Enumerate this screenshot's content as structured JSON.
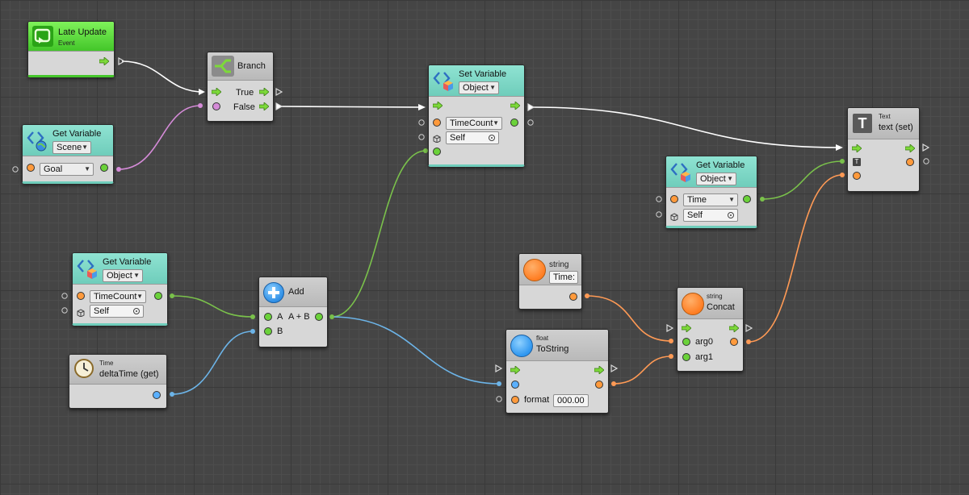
{
  "canvas": {
    "background": "#454545"
  },
  "colors": {
    "flow_wire": "#ffffff",
    "object_wire": "#ff9a55",
    "bool_wire": "#d58bd8",
    "float_wire": "#7ac14b",
    "deltatime_wire": "#6cb4e8"
  },
  "nodes": {
    "late_update": {
      "title": "Late Update",
      "subtitle": "Event",
      "icon": "loop-icon"
    },
    "branch": {
      "title": "Branch",
      "true_label": "True",
      "false_label": "False",
      "icon": "branch-icon"
    },
    "get_scene": {
      "title": "Get Variable",
      "scope": "Scene",
      "variable": "Goal",
      "icon": "variable-icon"
    },
    "set_variable": {
      "title": "Set Variable",
      "scope": "Object",
      "variable": "TimeCount",
      "target": "Self",
      "icon": "variable-icon"
    },
    "text_set": {
      "category": "Text",
      "title": "text (set)",
      "icon": "text-icon",
      "type_badge": "T"
    },
    "get_object_time": {
      "title": "Get Variable",
      "scope": "Object",
      "variable": "Time",
      "target": "Self",
      "icon": "variable-icon"
    },
    "get_object_timecount": {
      "title": "Get Variable",
      "scope": "Object",
      "variable": "TimeCount",
      "target": "Self",
      "icon": "variable-icon"
    },
    "add": {
      "title": "Add",
      "label_a": "A",
      "label_result": "A + B",
      "label_b": "B",
      "icon": "plus-icon"
    },
    "delta_time": {
      "category": "Time",
      "title": "deltaTime (get)",
      "icon": "clock-icon"
    },
    "string_literal": {
      "category": "string",
      "value": "Time:",
      "icon": "orange-circle-icon"
    },
    "concat": {
      "category": "string",
      "title": "Concat",
      "arg0": "arg0",
      "arg1": "arg1",
      "icon": "orange-circle-icon"
    },
    "to_string": {
      "category": "float",
      "title": "ToString",
      "format_label": "format",
      "format_value": "000.00",
      "icon": "blue-circle-icon"
    }
  }
}
